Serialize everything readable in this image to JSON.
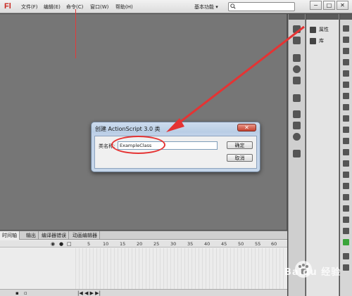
{
  "menubar": {
    "logo": "Fl",
    "items": [
      "文件(F)",
      "编辑(E)",
      "命令(C)",
      "窗口(W)",
      "帮助(H)"
    ],
    "workspace": "基本功能",
    "workspace_arrow": "▾",
    "search_placeholder": "",
    "window_buttons": [
      "−",
      "□",
      "✕"
    ]
  },
  "properties_panel": {
    "items": [
      {
        "label": "属性",
        "icon": "properties-icon"
      },
      {
        "label": "库",
        "icon": "library-icon"
      }
    ]
  },
  "timeline": {
    "tabs": [
      "时间轴",
      "输出",
      "编译器错误",
      "动画编辑器"
    ],
    "active_tab": 0,
    "frame_numbers": [
      "5",
      "10",
      "15",
      "20",
      "25",
      "30",
      "35",
      "40",
      "45",
      "50",
      "55",
      "60"
    ]
  },
  "dialog": {
    "title": "创建 ActionScript 3.0 类",
    "close_label": "✕",
    "class_name_label": "类名称:",
    "class_name_value": "ExampleClass",
    "ok_label": "确定",
    "cancel_label": "取消"
  },
  "annotation": {
    "color": "#e53333"
  },
  "watermark": {
    "text": "Baidu 经验"
  }
}
